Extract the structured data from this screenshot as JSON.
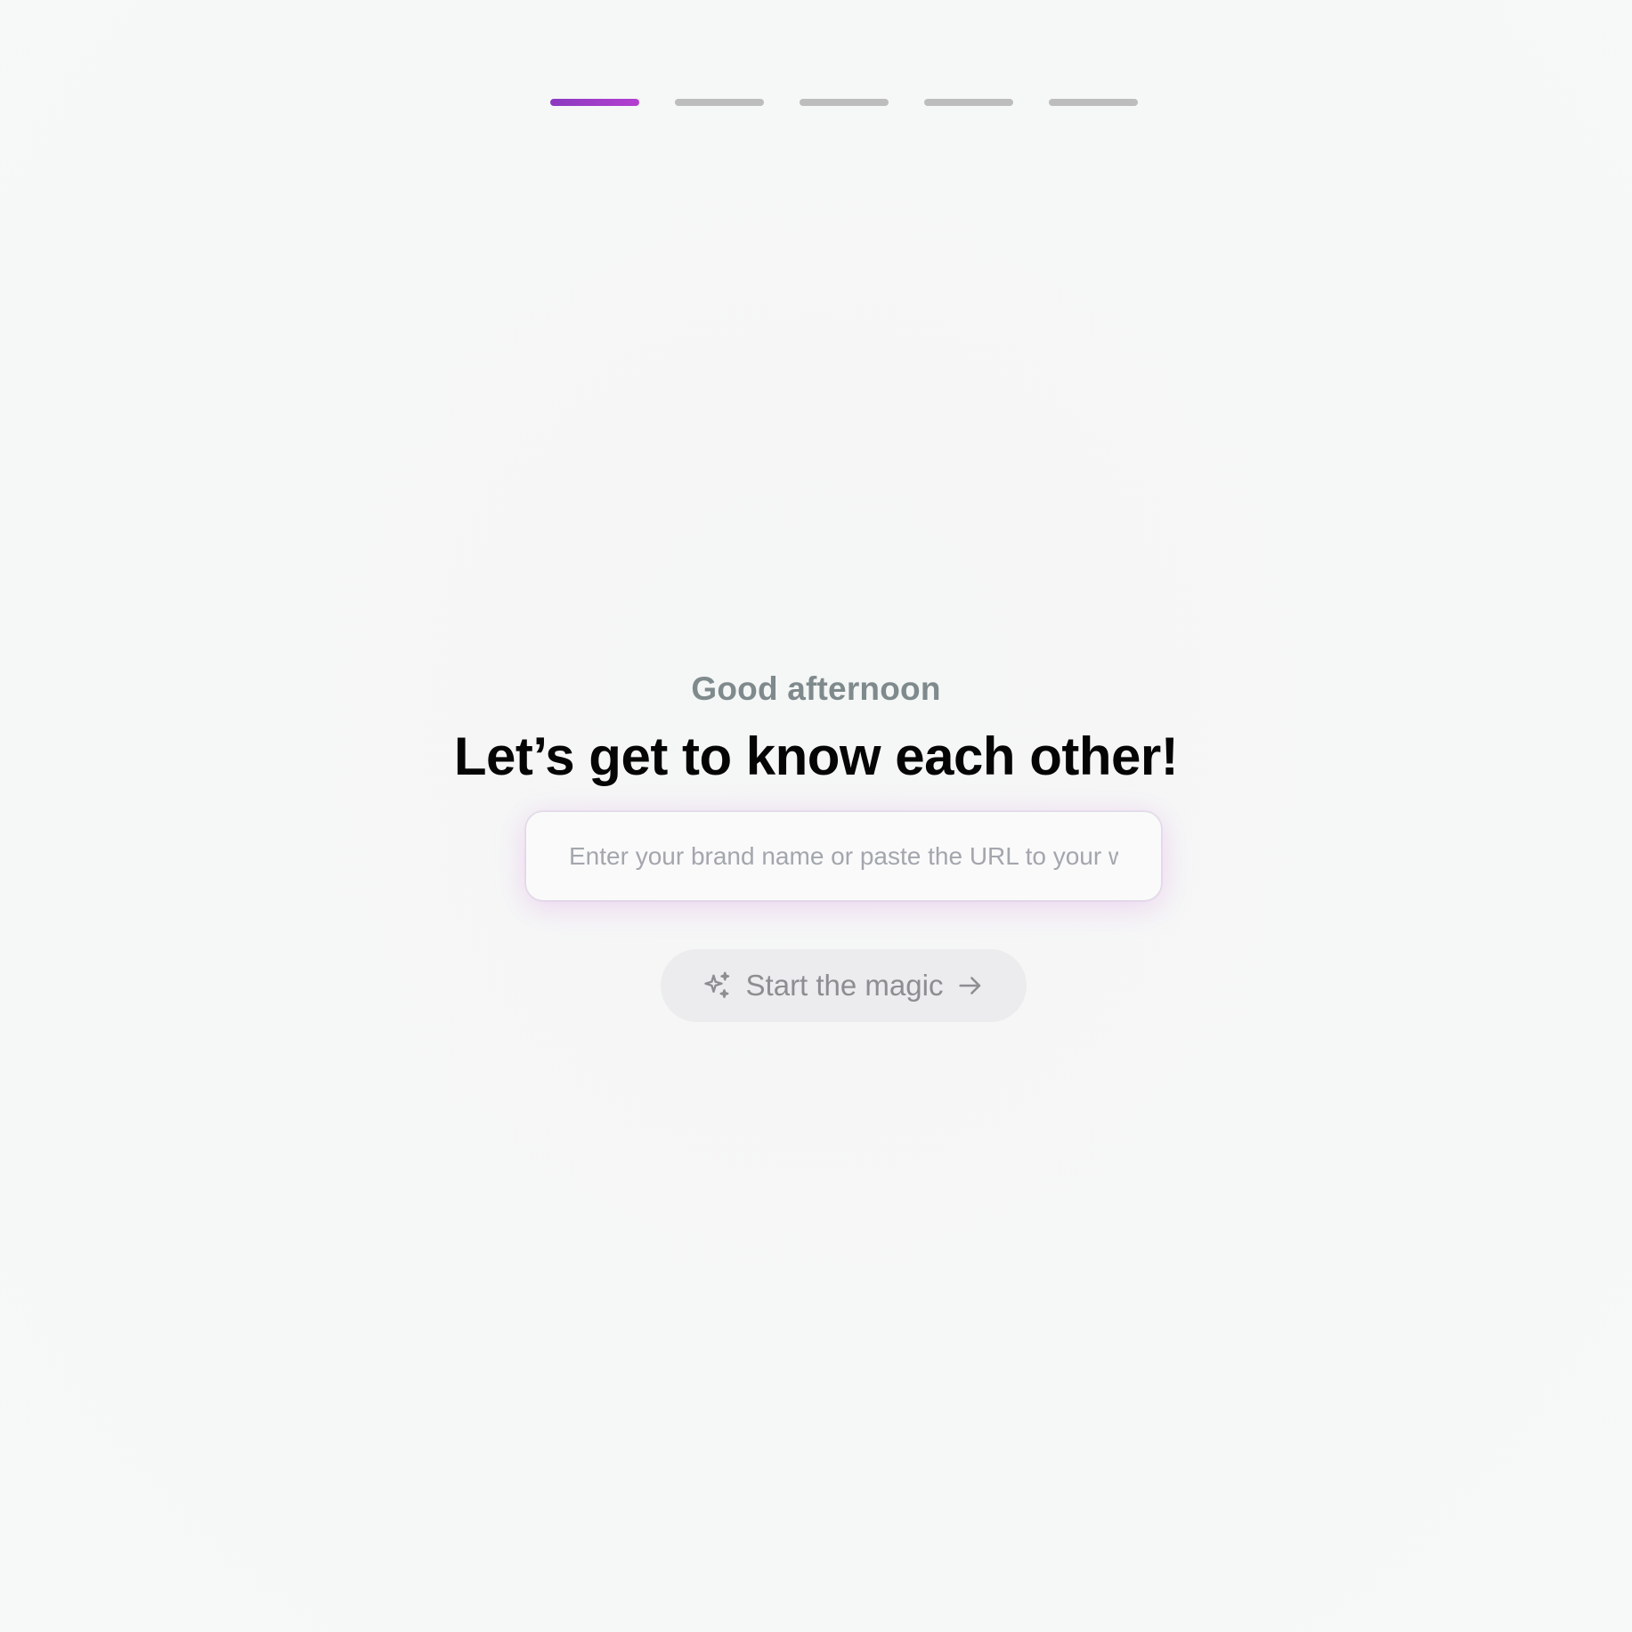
{
  "progress": {
    "current_step": 1,
    "total_steps": 5,
    "active_color": "#a63cc9",
    "inactive_color": "#bdbdbd"
  },
  "greeting": "Good afternoon",
  "headline": "Let’s get to know each other!",
  "brand_input": {
    "placeholder": "Enter your brand name or paste the URL to your website",
    "value": ""
  },
  "start_button": {
    "label": "Start the magic",
    "icon_left": "sparkles-icon",
    "icon_right": "arrow-right-icon",
    "enabled": false
  }
}
